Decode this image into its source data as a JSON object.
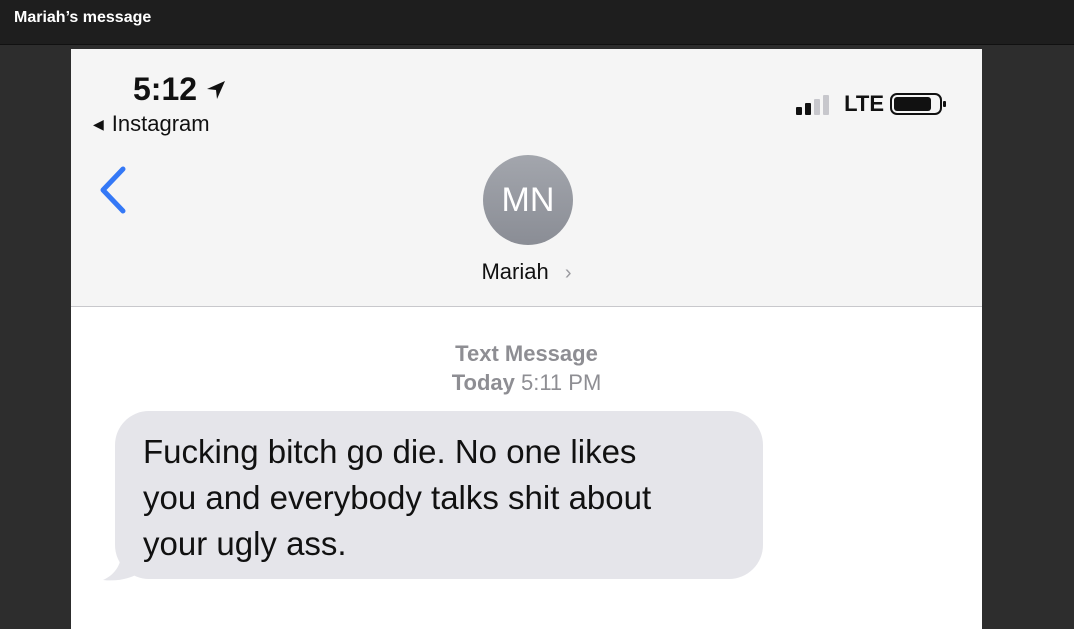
{
  "window": {
    "title": "Mariah’s message"
  },
  "status_bar": {
    "time": "5:12",
    "back_app": "Instagram",
    "network": "LTE"
  },
  "conversation": {
    "contact_initials": "MN",
    "contact_name": "Mariah",
    "chevron": "›",
    "label": "Text Message",
    "day": "Today",
    "time": "5:11 PM"
  },
  "message": {
    "lines": [
      "Fucking bitch go die. No one likes",
      "you and everybody talks shit about",
      "your ugly ass."
    ]
  },
  "icons": {
    "location": "location-arrow-icon",
    "back": "chevron-left-icon",
    "signal": "signal-bars-icon",
    "battery": "battery-icon"
  },
  "colors": {
    "ios_blue": "#3478f6",
    "bubble_gray": "#e5e5ea",
    "avatar_gray": "#9a9da4"
  }
}
